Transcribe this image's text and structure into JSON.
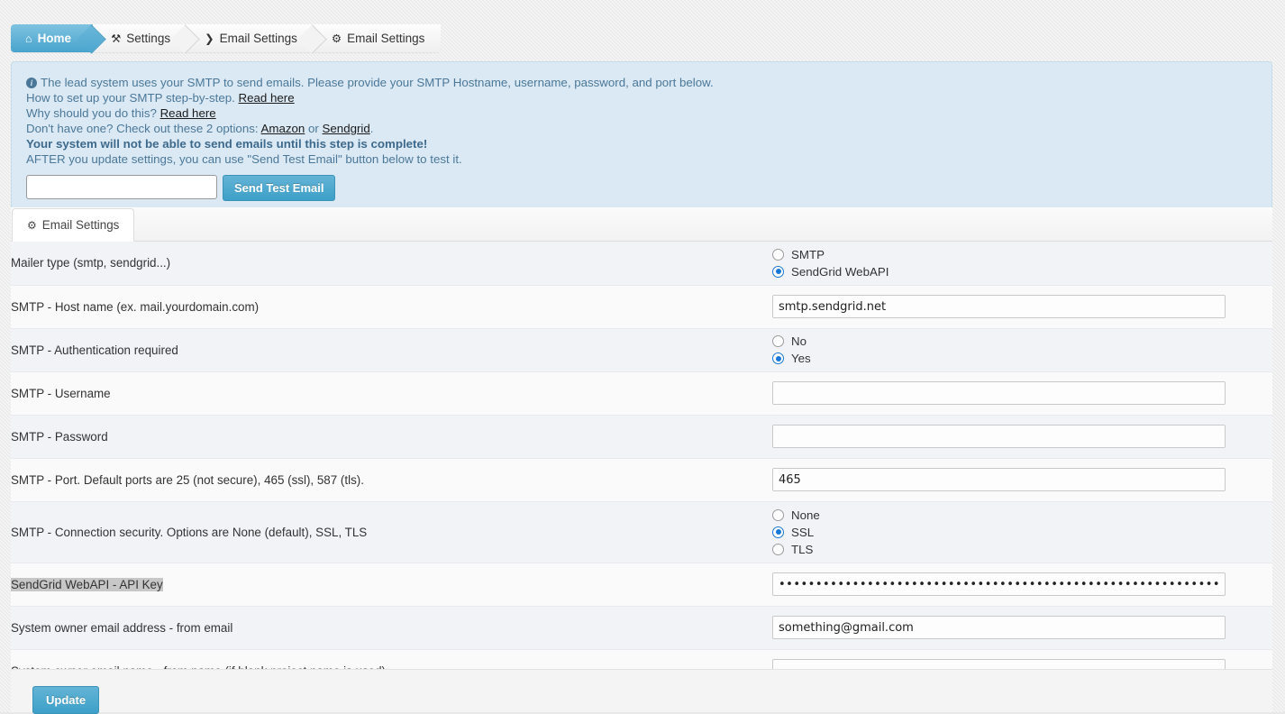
{
  "breadcrumb": {
    "items": [
      {
        "label": "Home",
        "icon": "home-icon",
        "glyph": "⌂",
        "active": true
      },
      {
        "label": "Settings",
        "icon": "wrench-icon",
        "glyph": "⚒"
      },
      {
        "label": "Email Settings",
        "icon": "chevron-right-icon",
        "glyph": "❯"
      },
      {
        "label": "Email Settings",
        "icon": "gears-icon",
        "glyph": "⚙"
      }
    ]
  },
  "alert": {
    "info_icon": "info-icon",
    "line1_pre": "The lead system uses your SMTP to send emails. Please provide your SMTP Hostname, username, password, and port below.",
    "line2_pre": "How to set up your SMTP step-by-step. ",
    "line2_link": "Read here",
    "line3_pre": "Why should you do this? ",
    "line3_link": "Read here",
    "line4_pre": "Don't have one? Check out these 2 options: ",
    "line4_link1": "Amazon",
    "line4_mid": " or ",
    "line4_link2": "Sendgrid",
    "line4_post": ".",
    "line5_bold": "Your system will not be able to send emails until this step is complete!",
    "line6": "AFTER you update settings, you can use \"Send Test Email\" button below to test it.",
    "test_email_value": "",
    "test_email_placeholder": "",
    "send_test_button": "Send Test Email"
  },
  "tab": {
    "label": "Email Settings",
    "icon": "gears-icon",
    "glyph": "⚙"
  },
  "rows": [
    {
      "label": "Mailer type (smtp, sendgrid...)",
      "type": "radio",
      "options": [
        {
          "label": "SMTP",
          "checked": false
        },
        {
          "label": "SendGrid WebAPI",
          "checked": true
        }
      ]
    },
    {
      "label": "SMTP - Host name (ex. mail.yourdomain.com)",
      "type": "text",
      "value": "smtp.sendgrid.net"
    },
    {
      "label": "SMTP - Authentication required",
      "type": "radio",
      "options": [
        {
          "label": "No",
          "checked": false
        },
        {
          "label": "Yes",
          "checked": true
        }
      ]
    },
    {
      "label": "SMTP - Username",
      "type": "text",
      "value": ""
    },
    {
      "label": "SMTP - Password",
      "type": "text",
      "value": ""
    },
    {
      "label": "SMTP - Port. Default ports are 25 (not secure), 465 (ssl), 587 (tls).",
      "type": "text",
      "value": "465"
    },
    {
      "label": "SMTP - Connection security. Options are None (default), SSL, TLS",
      "type": "radio",
      "options": [
        {
          "label": "None",
          "checked": false
        },
        {
          "label": "SSL",
          "checked": true
        },
        {
          "label": "TLS",
          "checked": false
        }
      ]
    },
    {
      "label": "SendGrid WebAPI - API Key",
      "label_selected": true,
      "type": "text",
      "value": "••••••••••••••••••••••••••••••••••••••••••••••••••••••••••••••••••••"
    },
    {
      "label": "System owner email address - from email",
      "type": "text",
      "value": "something@gmail.com"
    },
    {
      "label": "System owner email name - from name (if blank project name is used)",
      "type": "text",
      "value": ""
    }
  ],
  "footer": {
    "update_label": "Update"
  },
  "colors": {
    "accent": "#48a4cd",
    "alert_bg": "#dbe9f4",
    "alert_border": "#c5dbe9",
    "alert_text": "#4b7898",
    "radio_checked": "#1878d6",
    "row_odd": "#f1f3f7",
    "row_even": "#fafafa"
  }
}
